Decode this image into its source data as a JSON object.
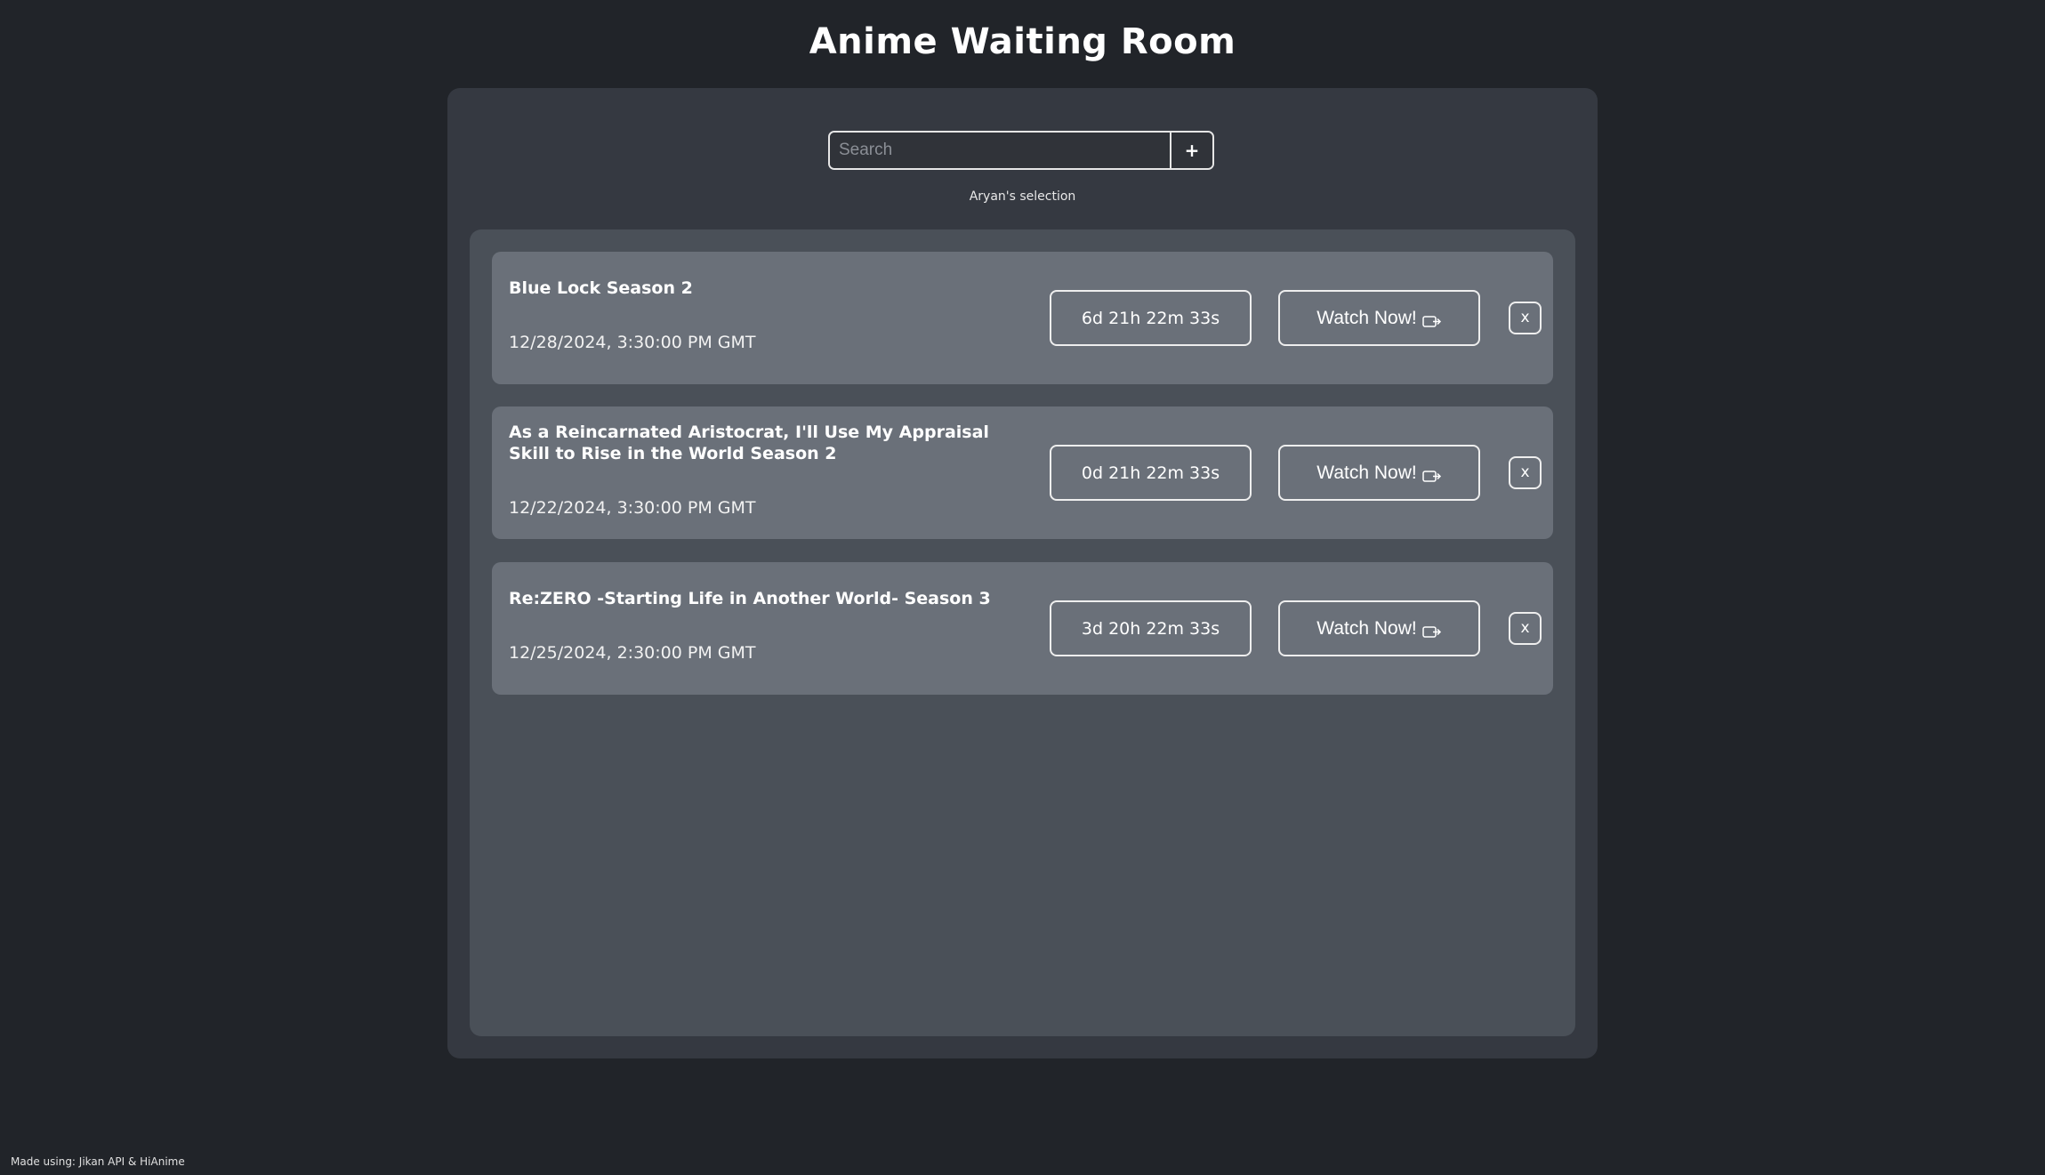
{
  "header": {
    "title": "Anime Waiting Room"
  },
  "search": {
    "placeholder": "Search",
    "value": "",
    "add_label": "+"
  },
  "selection": {
    "label": "Aryan's selection"
  },
  "anime_list": [
    {
      "title": "Blue Lock Season 2",
      "date": "12/28/2024, 3:30:00 PM GMT",
      "countdown": "6d 21h 22m 33s",
      "watch_label": "Watch Now!",
      "remove_label": "x"
    },
    {
      "title": "As a Reincarnated Aristocrat, I'll Use My Appraisal Skill to Rise in the World Season 2",
      "date": "12/22/2024, 3:30:00 PM GMT",
      "countdown": "0d 21h 22m 33s",
      "watch_label": "Watch Now!",
      "remove_label": "x"
    },
    {
      "title": "Re:ZERO -Starting Life in Another World- Season 3",
      "date": "12/25/2024, 2:30:00 PM GMT",
      "countdown": "3d 20h 22m 33s",
      "watch_label": "Watch Now!",
      "remove_label": "x"
    }
  ],
  "footer": {
    "text": "Made using: Jikan API & HiAnime"
  },
  "icons": {
    "watch": "external-link-icon"
  },
  "colors": {
    "background": "#212429",
    "panel": "#353941",
    "list": "#4a5058",
    "card": "#6a7079"
  }
}
